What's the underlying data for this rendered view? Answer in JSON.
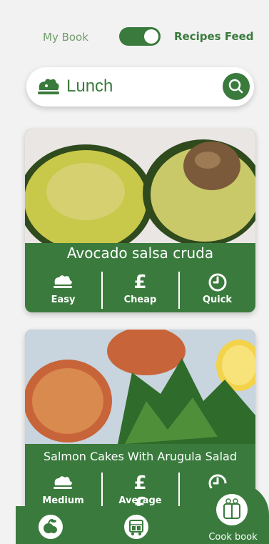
{
  "toggle": {
    "left_label": "My Book",
    "right_label": "Recipes Feed",
    "state": "Recipes Feed"
  },
  "search": {
    "value": "Lunch",
    "placeholder": ""
  },
  "recipes": [
    {
      "title": "Avocado salsa cruda",
      "attributes": [
        {
          "icon": "chef-hat-icon",
          "label": "Easy"
        },
        {
          "icon": "pound-icon",
          "symbol": "£",
          "label": "Cheap"
        },
        {
          "icon": "clock-icon",
          "label": "Quick"
        }
      ]
    },
    {
      "title": "Salmon Cakes With Arugula Salad",
      "attributes": [
        {
          "icon": "chef-hat-icon",
          "label": "Medium"
        },
        {
          "icon": "pound-icon",
          "symbol": "££",
          "label": "Average"
        },
        {
          "icon": "clock-icon",
          "label": ""
        }
      ]
    }
  ],
  "bottom_nav": [
    {
      "icon": "fruit-icon"
    },
    {
      "icon": "grocery-store-icon"
    },
    {
      "icon": "cook-book-icon",
      "label": "Cook book"
    }
  ],
  "colors": {
    "primary": "#3a7b3d",
    "background": "#f2f2f2",
    "text_light": "#6f9e6a"
  }
}
